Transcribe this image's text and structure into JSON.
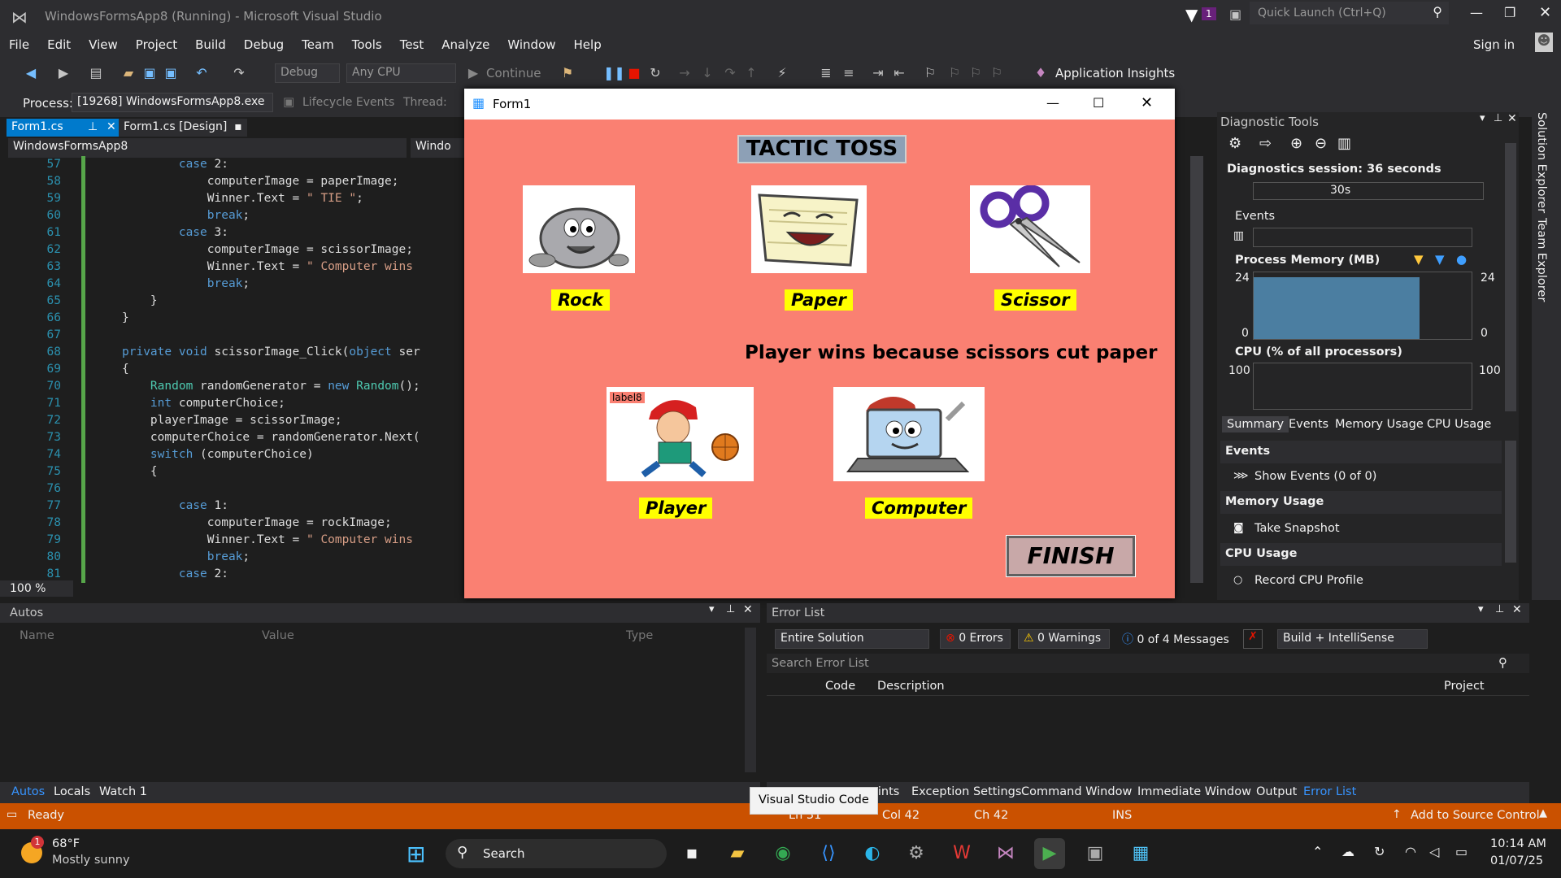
{
  "window_title": "WindowsFormsApp8 (Running) - Microsoft Visual Studio",
  "quick_launch_placeholder": "Quick Launch (Ctrl+Q)",
  "notif_count": "1",
  "sign_in": "Sign in",
  "menu": [
    "File",
    "Edit",
    "View",
    "Project",
    "Build",
    "Debug",
    "Team",
    "Tools",
    "Test",
    "Analyze",
    "Window",
    "Help"
  ],
  "toolbar": {
    "config": "Debug",
    "platform": "Any CPU",
    "continue": "Continue",
    "app_insights": "Application Insights"
  },
  "process_bar": {
    "label": "Process:",
    "process": "[19268] WindowsFormsApp8.exe",
    "lifecycle": "Lifecycle Events",
    "thread": "Thread:"
  },
  "editor_tabs": [
    {
      "label": "Form1.cs"
    },
    {
      "label": "Form1.cs [Design]"
    }
  ],
  "nav_combo": "WindowsFormsApp8",
  "nav_combo2": "Windo",
  "zoom": "100 %",
  "code_lines": [
    {
      "n": "57",
      "t": "        case 2:"
    },
    {
      "n": "58",
      "t": "            computerImage = paperImage;"
    },
    {
      "n": "59",
      "t": "            Winner.Text = \" TIE \";"
    },
    {
      "n": "60",
      "t": "            break;"
    },
    {
      "n": "61",
      "t": "        case 3:"
    },
    {
      "n": "62",
      "t": "            computerImage = scissorImage;"
    },
    {
      "n": "63",
      "t": "            Winner.Text = \" Computer wins"
    },
    {
      "n": "64",
      "t": "            break;"
    },
    {
      "n": "65",
      "t": "    }"
    },
    {
      "n": "66",
      "t": "}"
    },
    {
      "n": "67",
      "t": ""
    },
    {
      "n": "68",
      "t": "private void scissorImage_Click(object ser"
    },
    {
      "n": "69",
      "t": "{"
    },
    {
      "n": "70",
      "t": "    Random randomGenerator = new Random();"
    },
    {
      "n": "71",
      "t": "    int computerChoice;"
    },
    {
      "n": "72",
      "t": "    playerImage = scissorImage;"
    },
    {
      "n": "73",
      "t": "    computerChoice = randomGenerator.Next("
    },
    {
      "n": "74",
      "t": "    switch (computerChoice)"
    },
    {
      "n": "75",
      "t": "    {"
    },
    {
      "n": "76",
      "t": ""
    },
    {
      "n": "77",
      "t": "        case 1:"
    },
    {
      "n": "78",
      "t": "            computerImage = rockImage;"
    },
    {
      "n": "79",
      "t": "            Winner.Text = \" Computer wins"
    },
    {
      "n": "80",
      "t": "            break;"
    },
    {
      "n": "81",
      "t": "        case 2:"
    }
  ],
  "form": {
    "title": "Form1",
    "header": "TACTIC TOSS",
    "rock": "Rock",
    "paper": "Paper",
    "scissor": "Scissor",
    "result": "Player wins because scissors cut paper",
    "player": "Player",
    "computer": "Computer",
    "label8": "label8",
    "finish": "FINISH"
  },
  "diagnostics": {
    "title": "Diagnostic Tools",
    "session": "Diagnostics session: 36 seconds",
    "timeline_tick": "30s",
    "events": "Events",
    "process_memory": "Process Memory (MB)",
    "mem_max": "24",
    "mem_min": "0",
    "cpu": "CPU (% of all processors)",
    "cpu_max": "100",
    "tabs": [
      "Summary",
      "Events",
      "Memory Usage",
      "CPU Usage"
    ],
    "sec_events": "Events",
    "show_events": "Show Events (0 of 0)",
    "sec_memory": "Memory Usage",
    "take_snapshot": "Take Snapshot",
    "sec_cpu": "CPU Usage",
    "record_cpu": "Record CPU Profile"
  },
  "side_tabs": [
    "Solution Explorer",
    "Team Explorer"
  ],
  "autos": {
    "title": "Autos",
    "cols": [
      "Name",
      "Value",
      "Type"
    ],
    "tabs": [
      "Autos",
      "Locals",
      "Watch 1"
    ]
  },
  "error_list": {
    "title": "Error List",
    "scope": "Entire Solution",
    "errors": "0 Errors",
    "warnings": "0 Warnings",
    "messages": "0 of 4 Messages",
    "build": "Build + IntelliSense",
    "search": "Search Error List",
    "cols": [
      "Code",
      "Description",
      "Project"
    ],
    "tabs": [
      "oints",
      "Exception Settings",
      "Command Window",
      "Immediate Window",
      "Output",
      "Error List"
    ]
  },
  "tooltip": "Visual Studio Code",
  "status": {
    "ready": "Ready",
    "ln": "Ln 31",
    "col": "Col 42",
    "ch": "Ch 42",
    "ins": "INS",
    "source": "Add to Source Control"
  },
  "taskbar": {
    "temp": "68°F",
    "weather": "Mostly sunny",
    "search": "Search",
    "time": "10:14 AM",
    "date": "01/07/25"
  },
  "colors": {
    "form_bg": "#fa8072",
    "label_yellow": "#ffff00",
    "status_orange": "#ca5100",
    "vs_purple": "#68217a"
  }
}
